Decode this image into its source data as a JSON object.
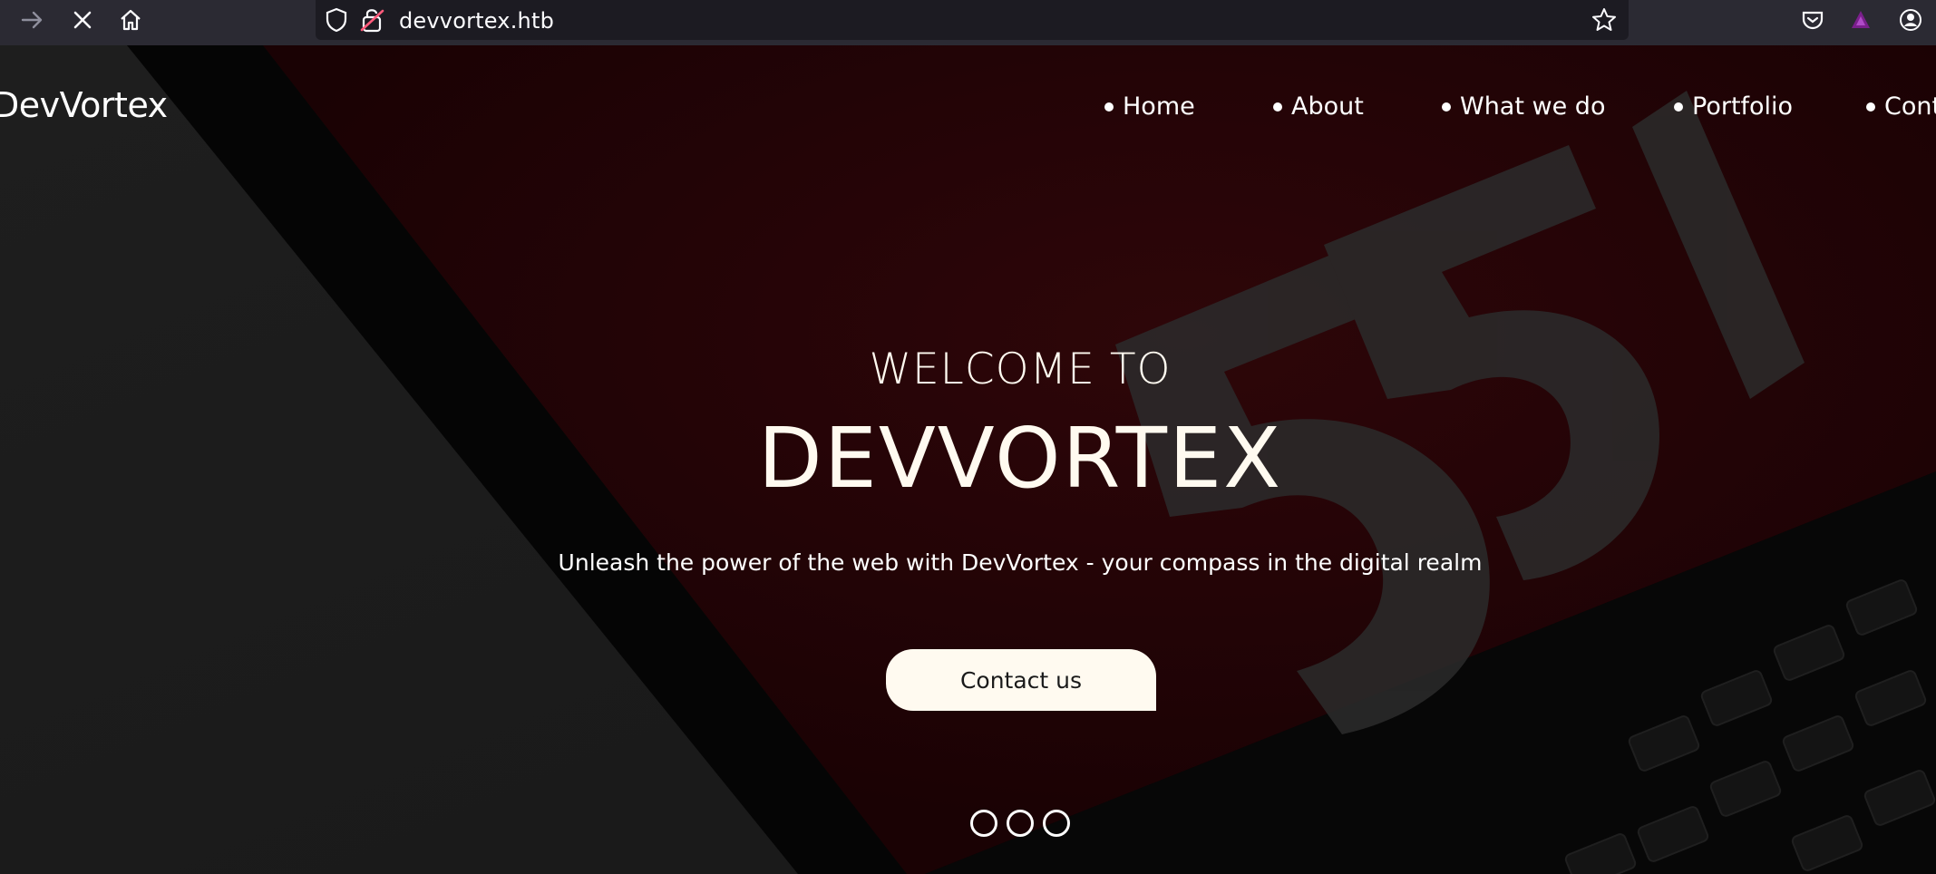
{
  "browser": {
    "url": "devvortex.htb",
    "icons": [
      "forward-arrow-icon",
      "stop-icon",
      "home-icon",
      "shield-icon",
      "insecure-lock-icon",
      "bookmark-star-icon",
      "pocket-icon",
      "extension-icon",
      "account-icon"
    ]
  },
  "site": {
    "brand": "DevVortex",
    "nav": [
      {
        "label": "Home"
      },
      {
        "label": "About"
      },
      {
        "label": "What we do"
      },
      {
        "label": "Portfolio"
      },
      {
        "label": "Cont"
      }
    ]
  },
  "hero": {
    "subtitle": "WELCOME TO",
    "title": "DEVVORTEX",
    "tagline": "Unleash the power of the web with DevVortex - your compass in the digital realm",
    "cta_label": "Contact us",
    "slide_count": 3
  },
  "colors": {
    "toolbar": "#2b2a33",
    "urlbar": "#1c1b22",
    "hero_text": "#fffaf0",
    "button_bg": "#fffaf0",
    "accent_red": "#2a0507"
  }
}
